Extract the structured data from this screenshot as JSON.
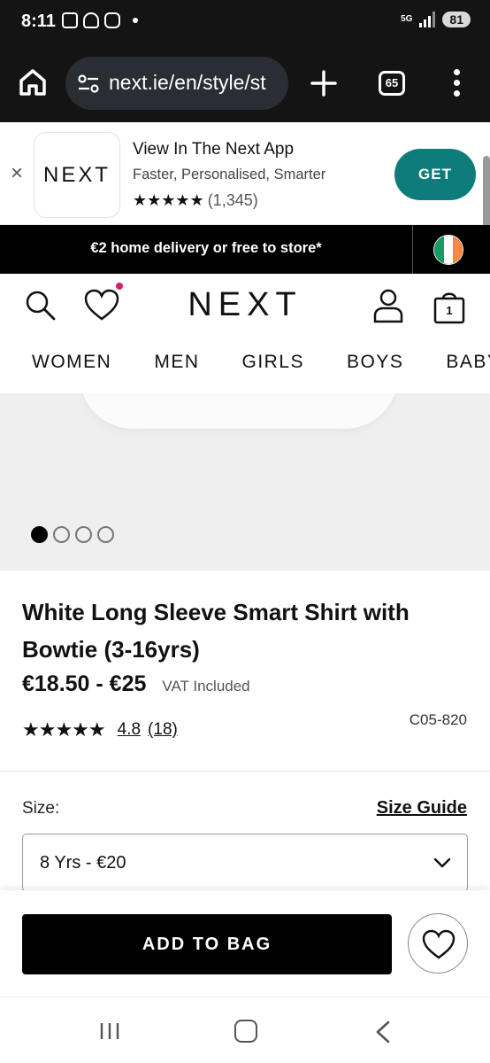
{
  "status_bar": {
    "time": "8:11",
    "network": "5G",
    "battery": "81"
  },
  "browser": {
    "url": "next.ie/en/style/st",
    "tab_count": "65"
  },
  "app_banner": {
    "logo_text": "NEXT",
    "title": "View In The Next App",
    "subtitle": "Faster, Personalised, Smarter",
    "stars": "★★★★★",
    "rating_count": "(1,345)",
    "get_label": "GET",
    "close_label": "×"
  },
  "delivery_banner": {
    "text": "€2 home delivery or free to store*"
  },
  "header": {
    "logo": "NEXT",
    "bag_count": "1",
    "nav": [
      "WOMEN",
      "MEN",
      "GIRLS",
      "BOYS",
      "BABY"
    ]
  },
  "product": {
    "title": "White Long Sleeve Smart Shirt with Bowtie (3-16yrs)",
    "price": "€18.50 - €25",
    "vat": "VAT Included",
    "stars": "★★★★★",
    "rating": "4.8",
    "reviews": "(18)",
    "code": "C05-820",
    "image_count": 4,
    "active_image": 1
  },
  "size": {
    "label": "Size:",
    "guide_label": "Size Guide",
    "selected": "8 Yrs - €20"
  },
  "actions": {
    "add_to_bag": "ADD TO BAG"
  },
  "colors": {
    "brand_teal": "#0d7c7a",
    "wishlist_dot": "#d6206b",
    "flag_green": "#169b62",
    "flag_white": "#ffffff",
    "flag_orange": "#ff883e"
  }
}
